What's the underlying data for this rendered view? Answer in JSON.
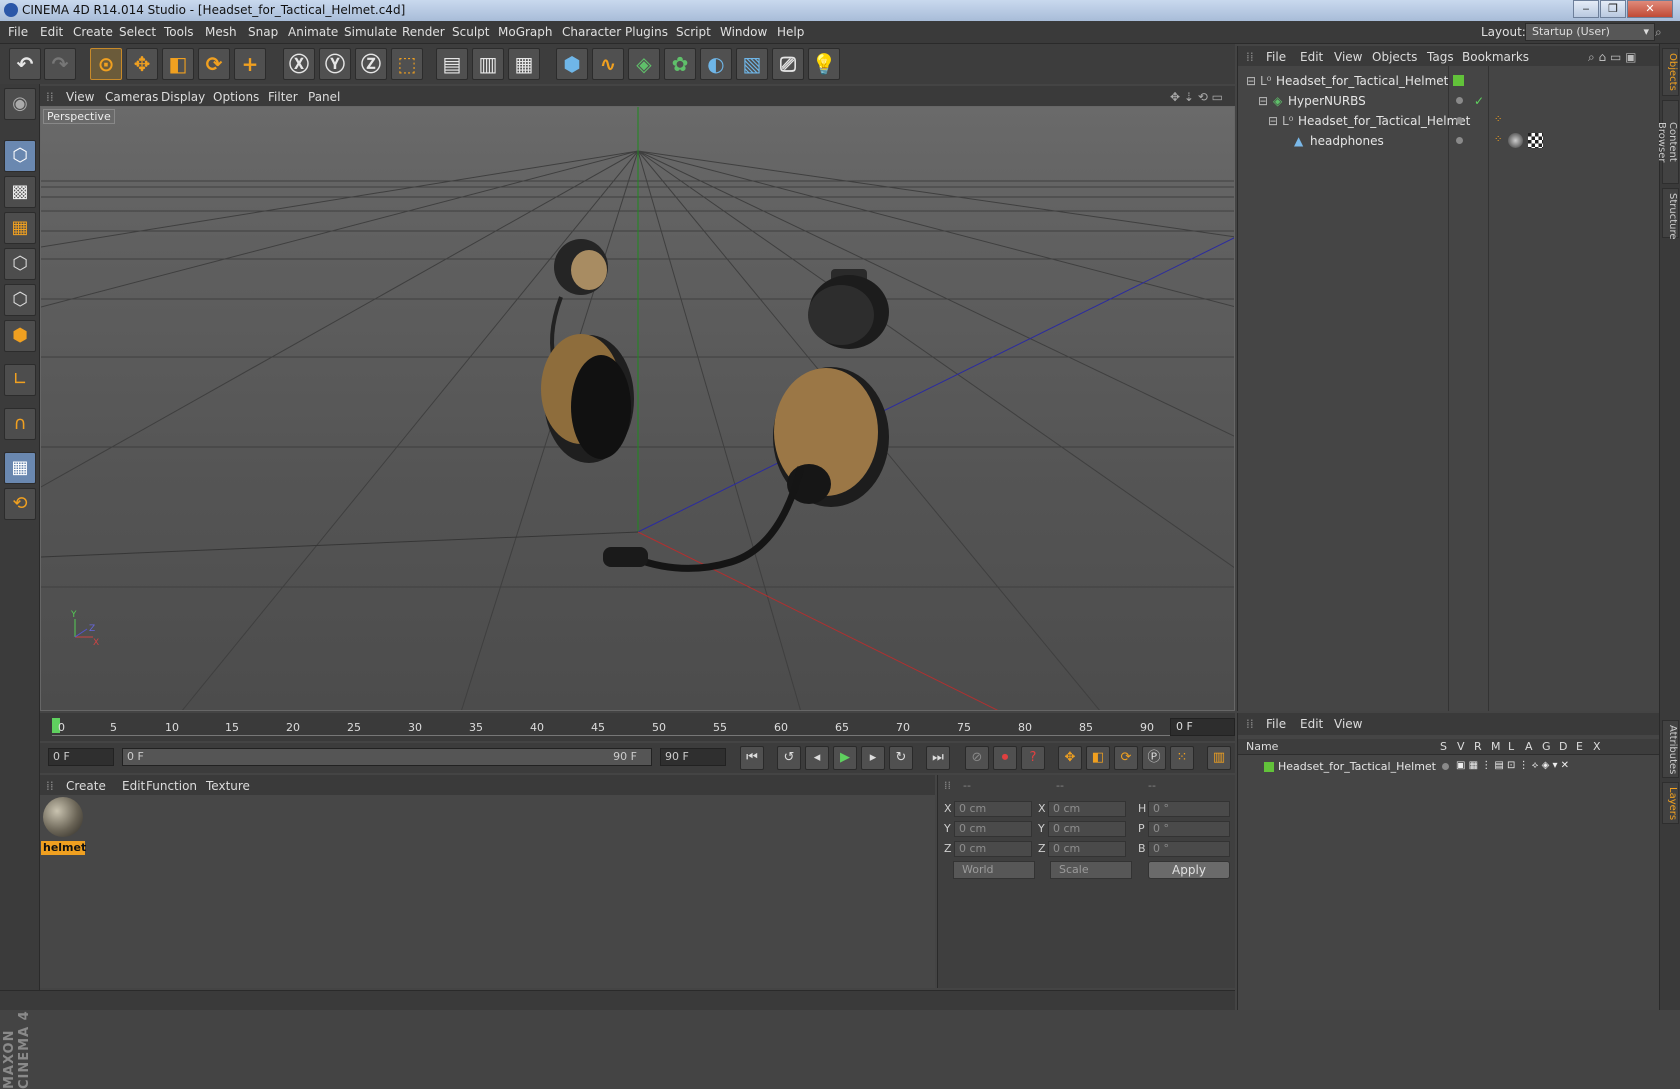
{
  "window": {
    "title": "CINEMA 4D R14.014 Studio - [Headset_for_Tactical_Helmet.c4d]",
    "min": "‒",
    "max": "❐",
    "close": "✕"
  },
  "menu": [
    "File",
    "Edit",
    "Create",
    "Select",
    "Tools",
    "Mesh",
    "Snap",
    "Animate",
    "Simulate",
    "Render",
    "Sculpt",
    "MoGraph",
    "Character",
    "Plugins",
    "Script",
    "Window",
    "Help"
  ],
  "layout": {
    "label": "Layout:",
    "value": "Startup (User)"
  },
  "viewport": {
    "menu": [
      "View",
      "Cameras",
      "Display",
      "Options",
      "Filter",
      "Panel"
    ],
    "label": "Perspective",
    "axis": {
      "y": "Y",
      "x": "X",
      "z": "Z"
    }
  },
  "timeline": {
    "ticks": [
      "0",
      "5",
      "10",
      "15",
      "20",
      "25",
      "30",
      "35",
      "40",
      "45",
      "50",
      "55",
      "60",
      "65",
      "70",
      "75",
      "80",
      "85",
      "90"
    ],
    "frame": "0 F"
  },
  "transport": {
    "start": "0 F",
    "range_start": "0 F",
    "range_end": "90 F",
    "end": "90 F"
  },
  "materials": {
    "menu": [
      "Create",
      "Edit",
      "Function",
      "Texture"
    ],
    "items": [
      {
        "name": "helmet"
      }
    ]
  },
  "coords": {
    "headers": [
      "--",
      "--",
      "--"
    ],
    "rows": [
      {
        "a": "X",
        "av": "0 cm",
        "b": "X",
        "bv": "0 cm",
        "c": "H",
        "cv": "0 °"
      },
      {
        "a": "Y",
        "av": "0 cm",
        "b": "Y",
        "bv": "0 cm",
        "c": "P",
        "cv": "0 °"
      },
      {
        "a": "Z",
        "av": "0 cm",
        "b": "Z",
        "bv": "0 cm",
        "c": "B",
        "cv": "0 °"
      }
    ],
    "space": "World",
    "mode": "Scale",
    "apply": "Apply"
  },
  "objects": {
    "menu": [
      "File",
      "Edit",
      "View",
      "Objects",
      "Tags",
      "Bookmarks"
    ],
    "tree": [
      {
        "name": "Headset_for_Tactical_Helmet"
      },
      {
        "name": "HyperNURBS"
      },
      {
        "name": "Headset_for_Tactical_Helmet"
      },
      {
        "name": "headphones"
      }
    ]
  },
  "layers": {
    "menu": [
      "File",
      "Edit",
      "View"
    ],
    "columns": [
      "Name",
      "S",
      "V",
      "R",
      "M",
      "L",
      "A",
      "G",
      "D",
      "E",
      "X"
    ],
    "rows": [
      {
        "name": "Headset_for_Tactical_Helmet"
      }
    ]
  },
  "sidetabs": [
    "Objects",
    "Content Browser",
    "Structure",
    "Attributes",
    "Layers"
  ],
  "brand": "MAXON CINEMA 4D",
  "colors": {
    "accent": "#f0a020",
    "layer_green": "#62c23a",
    "bg": "#444444"
  }
}
